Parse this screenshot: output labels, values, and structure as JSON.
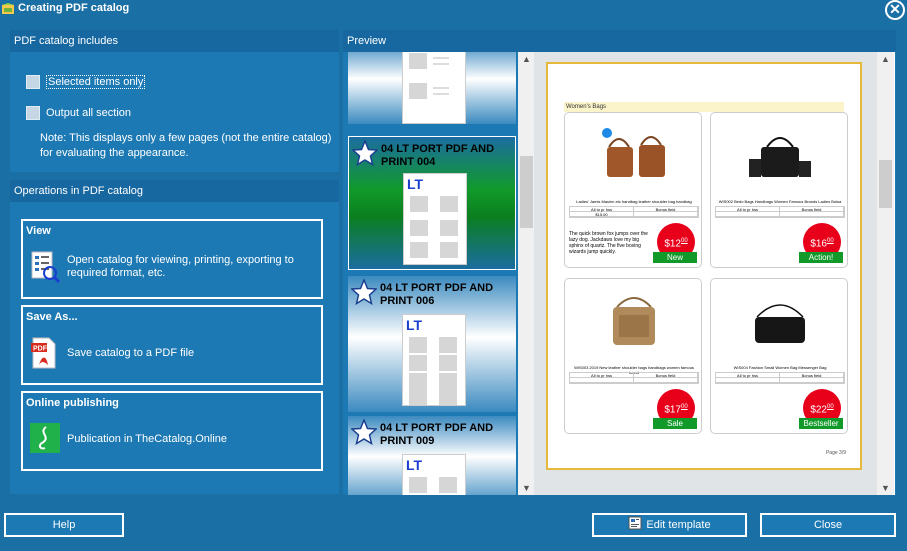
{
  "window": {
    "title": "Creating PDF catalog"
  },
  "includes_panel": {
    "heading": "PDF catalog includes",
    "options": [
      {
        "label": "Selected items only"
      },
      {
        "label": "Output all section"
      }
    ],
    "note": "Note: This displays only a few pages (not the entire catalog) for evaluating the appearance."
  },
  "operations_panel": {
    "heading": "Operations in PDF catalog",
    "view": {
      "title": "View",
      "desc": "Open catalog for viewing, printing, exporting to required format, etc."
    },
    "save_as": {
      "title": "Save As...",
      "desc": "Save catalog to a PDF file"
    },
    "online": {
      "title": "Online publishing",
      "desc": "Publication in TheCatalog.Online"
    }
  },
  "preview": {
    "heading": "Preview",
    "thumbnails": [
      {
        "label": "04 LT PORT PDF AND PRINT 004",
        "mini_logo": "LT"
      },
      {
        "label": "04 LT PORT PDF AND PRINT 006",
        "mini_logo": "LT"
      },
      {
        "label": "04 LT PORT PDF AND PRINT 009",
        "mini_logo": "LT"
      }
    ],
    "page": {
      "section": "Women's Bags",
      "page_num": "Page 3/9",
      "products": [
        {
          "desc": "Ladies' Jamis Masinn etc handbag leather shoulder bag handbag",
          "price": "$12",
          "cents": "00",
          "tag": "New",
          "blurb": "The quick brown fox jumps over the lazy dog. Jackdaws love my big sphinx of quartz. The five boxing wizards jump quickly."
        },
        {
          "desc": "WIS002 Bedo Bags Handbags Women Famous Brands Ladies Bolsa",
          "price": "$16",
          "cents": "00",
          "tag": "Action!",
          "blurb": ""
        },
        {
          "desc": "WIS003 2019 New leather shoulder bags handbags women famous brand",
          "price": "$17",
          "cents": "00",
          "tag": "Sale",
          "blurb": ""
        },
        {
          "desc": "WIS004 Fashion Small Women Bag Messenger Bag",
          "price": "$22",
          "cents": "00",
          "tag": "Bestseller",
          "blurb": ""
        }
      ],
      "table": {
        "h1": "All to pr hss",
        "h2": "Bonus field",
        "v1": "$15.00",
        "v2": ""
      }
    }
  },
  "footer": {
    "help": "Help",
    "edit_template": "Edit template",
    "close": "Close"
  },
  "colors": {
    "accent": "#1a6fa5",
    "panel": "#1c79b4",
    "active_thumb": "#119a2a",
    "price": "#e8001a"
  }
}
